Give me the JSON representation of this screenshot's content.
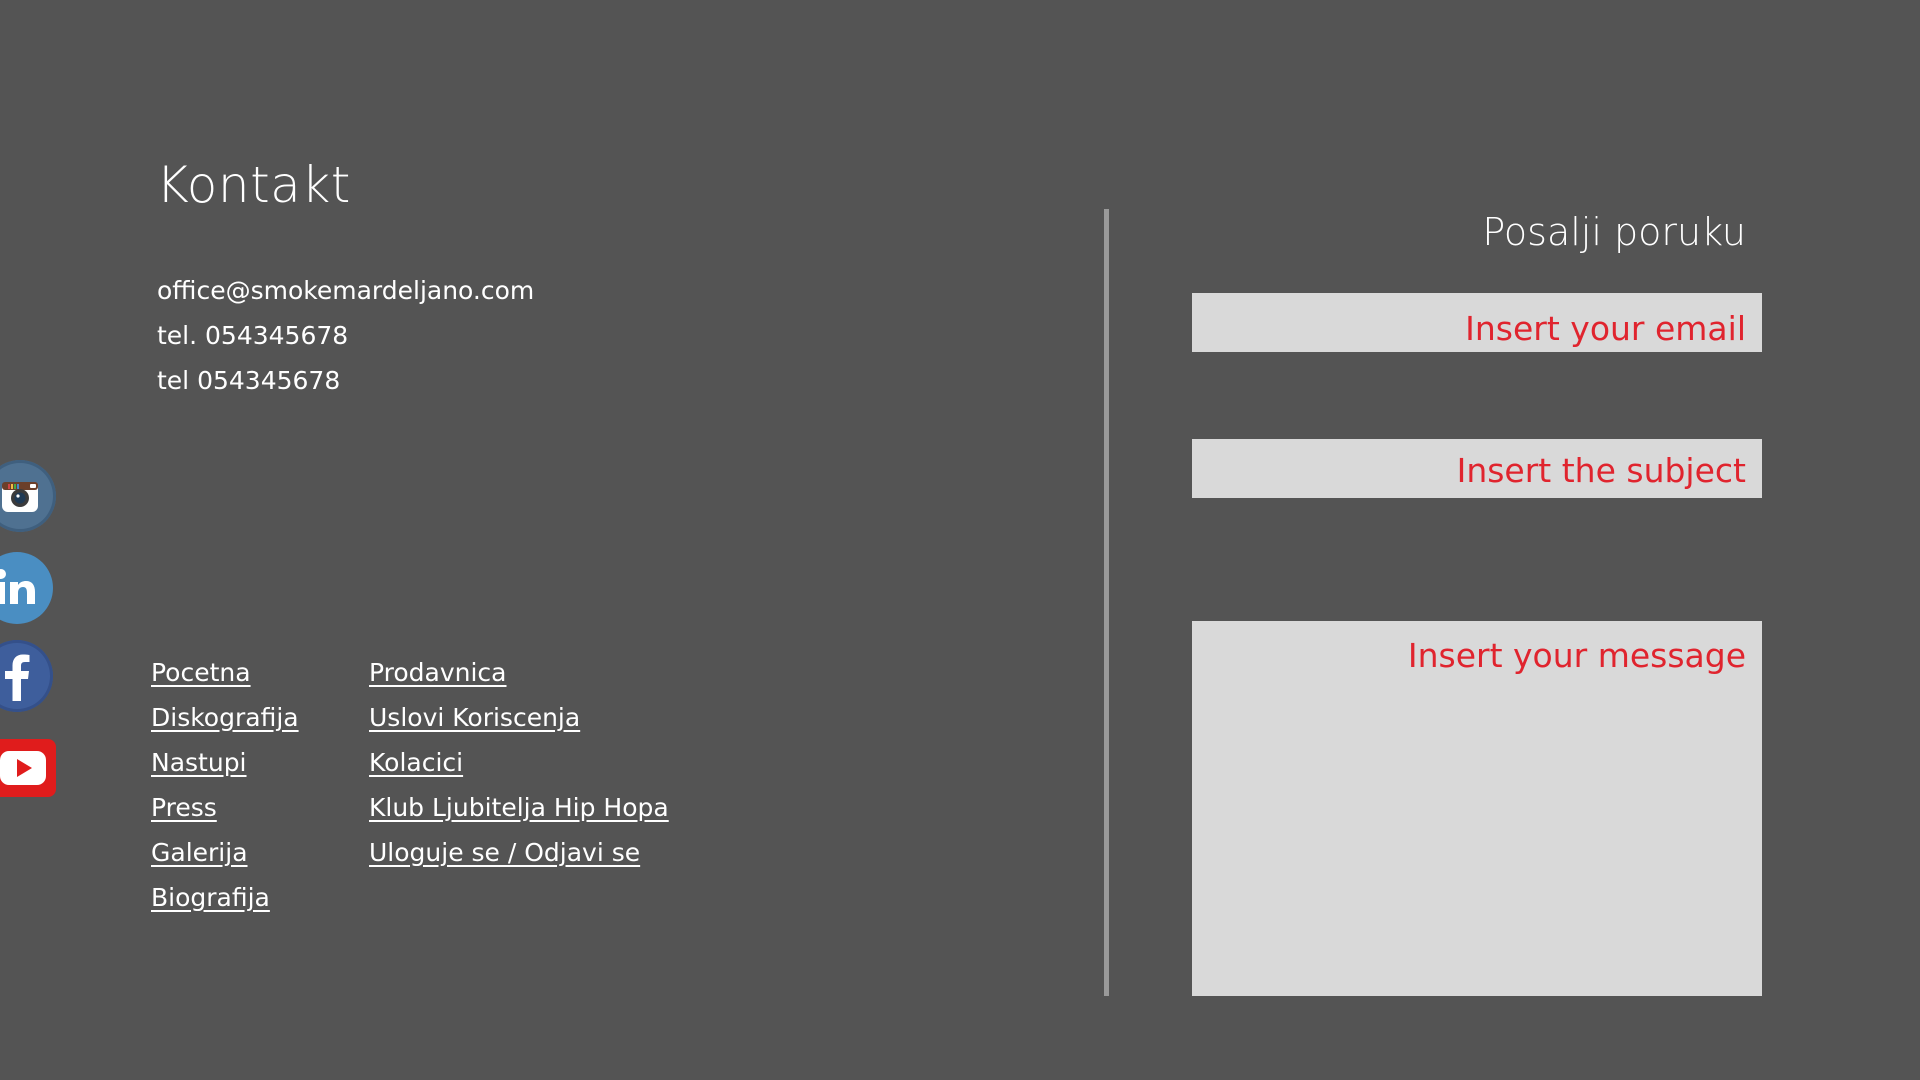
{
  "contact": {
    "title": "Kontakt",
    "email": "office@smokemardeljano.com",
    "phone1": "tel. 054345678",
    "phone2": "tel 054345678"
  },
  "social": {
    "instagram": "instagram-icon",
    "linkedin": "linkedin-icon",
    "facebook": "facebook-icon",
    "youtube": "youtube-icon"
  },
  "links": {
    "col1": [
      "Pocetna",
      "Diskografija",
      "Nastupi",
      "Press",
      "Galerija",
      "Biografija"
    ],
    "col2": [
      "Prodavnica",
      "Uslovi Koriscenja",
      "Kolacici",
      "Klub Ljubitelja Hip Hopa",
      "Uloguje se / Odjavi se"
    ]
  },
  "form": {
    "title": "Posalji poruku",
    "email_placeholder": "Insert your email",
    "subject_placeholder": "Insert the subject",
    "message_placeholder": "Insert your message"
  },
  "colors": {
    "background": "#545454",
    "placeholder_text": "#e0242e",
    "field_background": "#d9d9d9",
    "divider": "#9a9a9a"
  }
}
